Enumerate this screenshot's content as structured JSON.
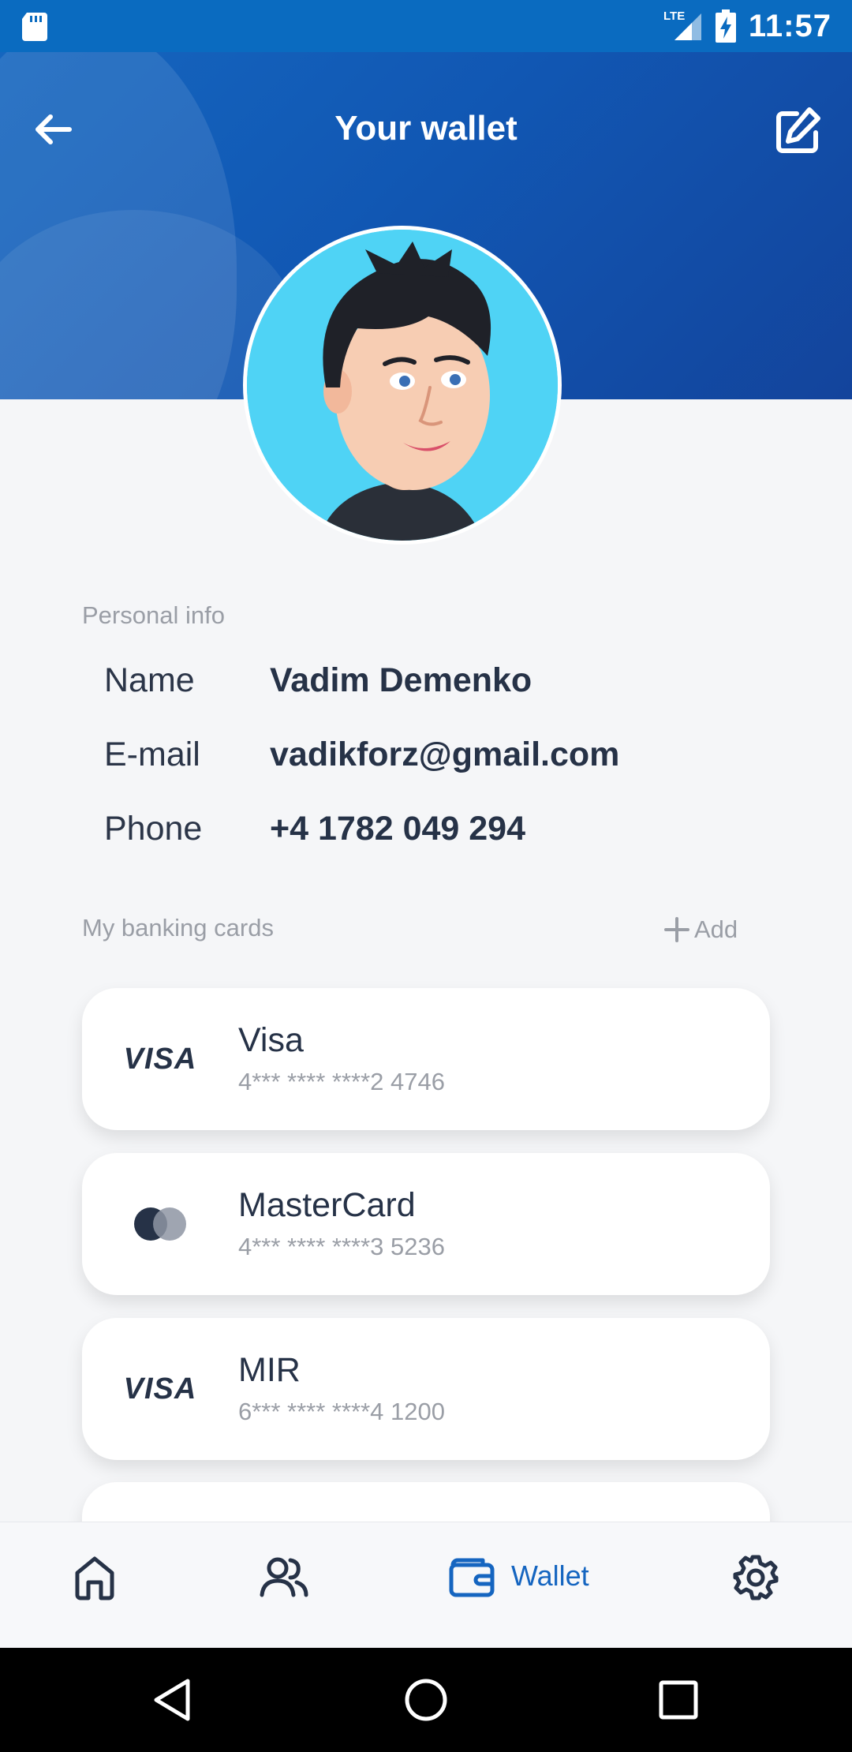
{
  "status_bar": {
    "network": "LTE",
    "time": "11:57"
  },
  "header": {
    "title": "Your wallet"
  },
  "personal_info": {
    "section_label": "Personal info",
    "rows": [
      {
        "key": "Name",
        "value": "Vadim Demenko"
      },
      {
        "key": "E-mail",
        "value": "vadikforz@gmail.com"
      },
      {
        "key": "Phone",
        "value": "+4 1782 049 294"
      }
    ]
  },
  "cards": {
    "section_label": "My banking cards",
    "add_label": "Add",
    "items": [
      {
        "logo": "visa-logo",
        "logo_text": "VISA",
        "name": "Visa",
        "number": "4*** **** ****2 4746"
      },
      {
        "logo": "mastercard-logo",
        "name": "MasterCard",
        "number": "4*** **** ****3 5236"
      },
      {
        "logo": "visa-logo",
        "logo_text": "VISA",
        "name": "MIR",
        "number": "6*** **** ****4 1200"
      }
    ]
  },
  "bottom_nav": {
    "items": [
      {
        "icon": "home-icon"
      },
      {
        "icon": "users-icon"
      },
      {
        "icon": "wallet-icon",
        "label": "Wallet",
        "active": true
      },
      {
        "icon": "settings-icon"
      }
    ]
  },
  "colors": {
    "accent": "#1565c0",
    "header": "#1157b3",
    "text_dark": "#263247",
    "text_muted": "#9a9ea6"
  }
}
